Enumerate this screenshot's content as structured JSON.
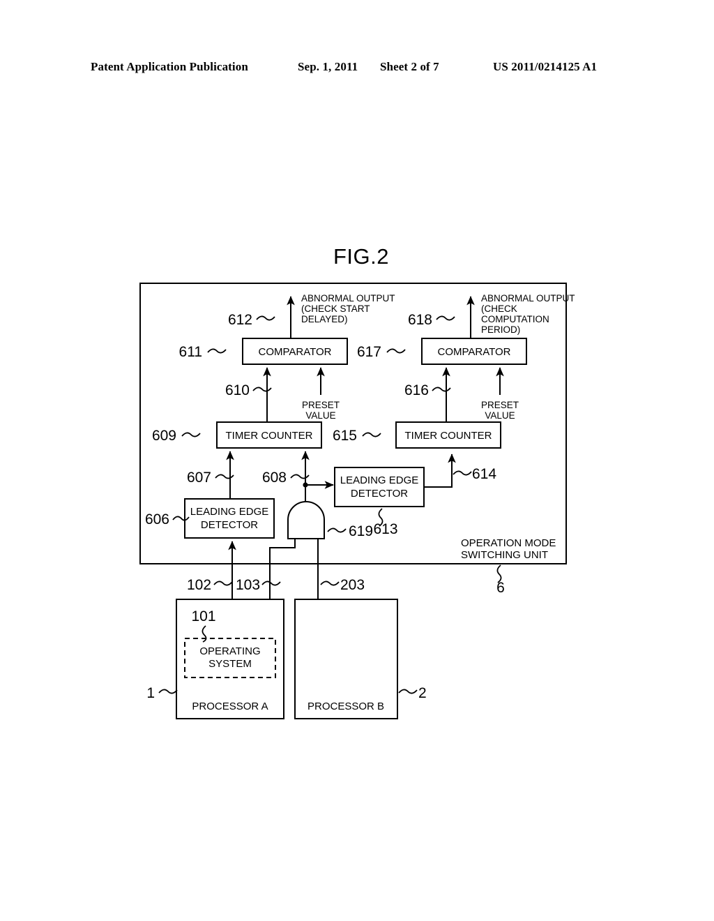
{
  "header": {
    "publication": "Patent Application Publication",
    "date": "Sep. 1, 2011",
    "sheet": "Sheet 2 of 7",
    "patent_number": "US 2011/0214125 A1"
  },
  "figure": {
    "title": "FIG.2"
  },
  "diagram": {
    "outer_unit_label_line1": "OPERATION MODE",
    "outer_unit_label_line2": "SWITCHING UNIT",
    "outer_unit_ref": "6",
    "blocks": {
      "comparator_left": {
        "label": "COMPARATOR",
        "ref": "611"
      },
      "comparator_right": {
        "label": "COMPARATOR",
        "ref": "617"
      },
      "timer_counter_left": {
        "label": "TIMER COUNTER",
        "ref": "609"
      },
      "timer_counter_right": {
        "label": "TIMER COUNTER",
        "ref": "615"
      },
      "leading_edge_detector_left": {
        "label_line1": "LEADING EDGE",
        "label_line2": "DETECTOR",
        "ref": "606"
      },
      "leading_edge_detector_right": {
        "label_line1": "LEADING EDGE",
        "label_line2": "DETECTOR",
        "ref": "613"
      },
      "and_gate": {
        "ref": "619"
      },
      "processor_a": {
        "label": "PROCESSOR A",
        "ref": "1"
      },
      "processor_b": {
        "label": "PROCESSOR B",
        "ref": "2"
      },
      "operating_system": {
        "label_line1": "OPERATING",
        "label_line2": "SYSTEM",
        "ref": "101"
      }
    },
    "outputs": {
      "left": {
        "ref": "612",
        "line1": "ABNORMAL OUTPUT",
        "line2": "(CHECK START",
        "line3": "DELAYED)"
      },
      "right": {
        "ref": "618",
        "line1": "ABNORMAL OUTPUT",
        "line2": "(CHECK",
        "line3": "COMPUTATION",
        "line4": "PERIOD)"
      }
    },
    "preset_left": {
      "line1": "PRESET",
      "line2": "VALUE"
    },
    "preset_right": {
      "line1": "PRESET",
      "line2": "VALUE"
    },
    "signal_refs": {
      "s610": "610",
      "s616": "616",
      "s607": "607",
      "s608": "608",
      "s614": "614",
      "s102": "102",
      "s103": "103",
      "s203": "203"
    }
  }
}
